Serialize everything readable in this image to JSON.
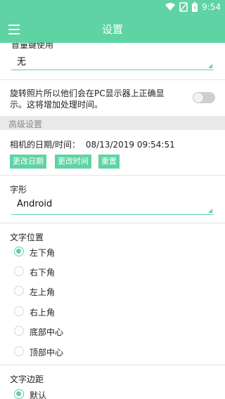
{
  "status": {
    "time": "9:54"
  },
  "appbar": {
    "title": "设置"
  },
  "volume_key": {
    "label": "音量键使用",
    "value": "无"
  },
  "rotate": {
    "text_line1": "旋转照片所以他们会在PC显示器上正确显",
    "text_line2": "示。这将增加处理时间。",
    "enabled": false
  },
  "advanced": {
    "header": "高级设置",
    "camera_datetime_label": "相机的日期/时间：",
    "camera_datetime_value": "08/13/2019 09:54:51",
    "buttons": [
      "更改日期",
      "更改时间",
      "重置"
    ]
  },
  "font": {
    "label": "字形",
    "value": "Android"
  },
  "text_position": {
    "label": "文字位置",
    "options": [
      "左下角",
      "右下角",
      "左上角",
      "右上角",
      "底部中心",
      "顶部中心"
    ],
    "selected": "左下角"
  },
  "text_margin": {
    "label": "文字边距",
    "options": [
      "默认"
    ],
    "selected": "默认"
  },
  "colors": {
    "accent": "#5fd3a4"
  }
}
